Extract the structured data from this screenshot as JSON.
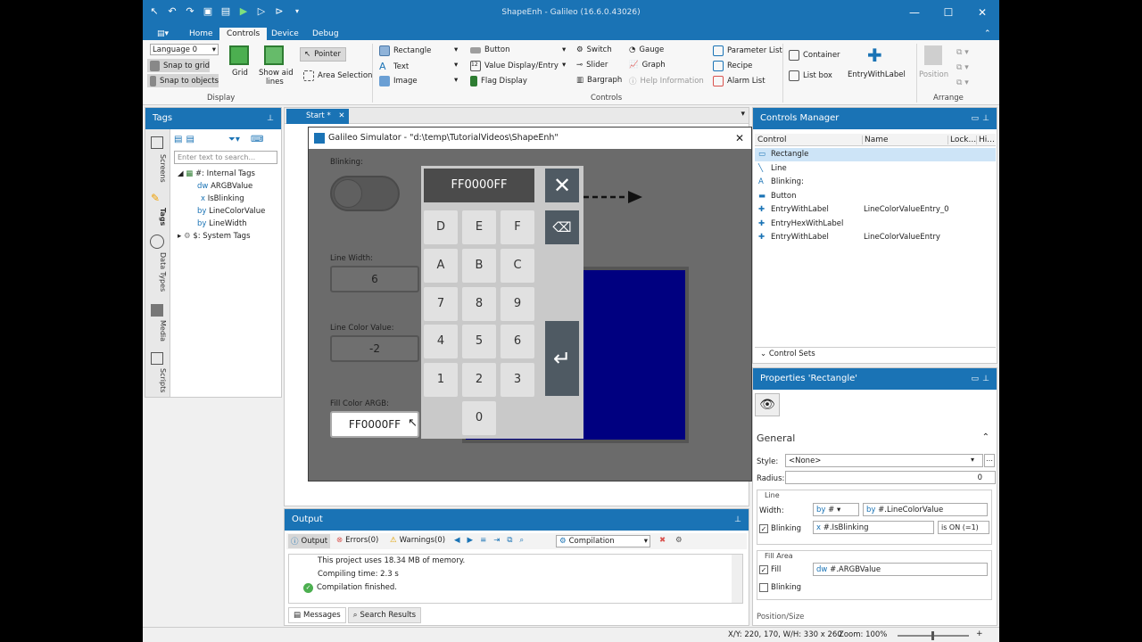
{
  "window": {
    "title": "ShapeEnh - Galileo (16.6.0.43026)"
  },
  "ribbon_tabs": [
    "Home",
    "Controls",
    "Device",
    "Debug"
  ],
  "display": {
    "language": "Language 0",
    "snap_grid": "Snap to grid",
    "snap_objects": "Snap to objects",
    "grid": "Grid",
    "show_aid": "Show aid",
    "lines": "lines",
    "pointer": "Pointer",
    "area_selection": "Area Selection",
    "group": "Display"
  },
  "controls_items": {
    "rectangle": "Rectangle",
    "text": "Text",
    "image": "Image",
    "button": "Button",
    "value_display": "Value Display/Entry",
    "flag_display": "Flag Display",
    "switch": "Switch",
    "slider": "Slider",
    "bargraph": "Bargraph",
    "gauge": "Gauge",
    "graph": "Graph",
    "help_info": "Help Information",
    "param_list": "Parameter List",
    "recipe": "Recipe",
    "alarm_list": "Alarm List",
    "container": "Container",
    "list_box": "List box",
    "entry_with_label": "EntryWithLabel",
    "group": "Controls"
  },
  "arrange": {
    "position": "Position",
    "group": "Arrange"
  },
  "tags_panel": {
    "title": "Tags",
    "search_placeholder": "Enter text to search...",
    "vtabs": [
      "Screens",
      "Tags",
      "Data Types",
      "Media",
      "Scripts"
    ],
    "tree": {
      "internal": "#: Internal Tags",
      "items": [
        {
          "type": "dw",
          "name": "ARGBValue"
        },
        {
          "type": "x",
          "name": "IsBlinking"
        },
        {
          "type": "by",
          "name": "LineColorValue"
        },
        {
          "type": "by",
          "name": "LineWidth"
        }
      ],
      "system": "$: System Tags"
    }
  },
  "doc_tab": {
    "label": "Start *"
  },
  "simulator": {
    "title": "Galileo Simulator - \"d:\\temp\\TutorialVideos\\ShapeEnh\"",
    "blinking_label": "Blinking:",
    "line_width_label": "Line Width:",
    "line_width_value": "6",
    "line_color_label": "Line Color Value:",
    "line_color_value": "-2",
    "fill_color_label": "Fill Color ARGB:",
    "fill_color_value": "FF0000FF",
    "keypad": {
      "display": "FF0000FF",
      "keys": [
        "D",
        "E",
        "F",
        "A",
        "B",
        "C",
        "7",
        "8",
        "9",
        "4",
        "5",
        "6",
        "1",
        "2",
        "3",
        "0"
      ]
    }
  },
  "output": {
    "title": "Output",
    "tabs": {
      "output": "Output",
      "errors": "Errors(0)",
      "warnings": "Warnings(0)"
    },
    "filter": "Compilation",
    "lines": [
      "This project uses 18.34 MB of memory.",
      "Compiling time: 2.3 s",
      "Compilation finished."
    ],
    "bottom_tabs": [
      "Messages",
      "Search Results"
    ]
  },
  "controls_manager": {
    "title": "Controls Manager",
    "columns": [
      "Control",
      "Name",
      "Lock...",
      "Hi..."
    ],
    "rows": [
      {
        "control": "Rectangle",
        "name": ""
      },
      {
        "control": "Line",
        "name": ""
      },
      {
        "control": "Blinking:",
        "name": ""
      },
      {
        "control": "Button",
        "name": ""
      },
      {
        "control": "EntryWithLabel",
        "name": "LineColorValueEntry_0"
      },
      {
        "control": "EntryHexWithLabel",
        "name": ""
      },
      {
        "control": "EntryWithLabel",
        "name": "LineColorValueEntry"
      }
    ],
    "control_sets": "Control Sets"
  },
  "properties": {
    "title": "Properties 'Rectangle'",
    "section": "General",
    "style_label": "Style:",
    "style_value": "<None>",
    "radius_label": "Radius:",
    "radius_value": "0",
    "line_group": "Line",
    "width_label": "Width:",
    "width_type": "by",
    "width_type2": "#",
    "width_bind_type": "by",
    "width_value": "#.LineColorValue",
    "blinking_label": "Blinking",
    "blinking_type": "x",
    "blinking_value": "#.IsBlinking",
    "blinking_cond": "is ON (=1)",
    "fill_group": "Fill Area",
    "fill_label": "Fill",
    "fill_type": "dw",
    "fill_value": "#.ARGBValue",
    "fill_blinking": "Blinking",
    "next_section": "Position/Size"
  },
  "status": {
    "coords": "X/Y: 220, 170, W/H: 330 x 260",
    "zoom": "Zoom: 100%"
  },
  "colors": {
    "accent": "#1a73b5",
    "rect_fill": "#000080"
  }
}
